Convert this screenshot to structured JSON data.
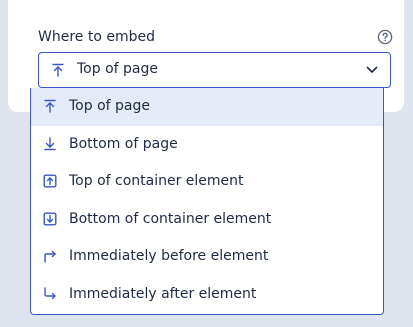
{
  "field": {
    "label": "Where to embed",
    "help_icon": "question-circle-icon",
    "selected_value": "Top of page",
    "selected_icon": "arrow-to-top-icon",
    "dropdown_icon": "chevron-down-icon"
  },
  "options": [
    {
      "label": "Top of page",
      "icon": "arrow-to-top-icon",
      "selected": true
    },
    {
      "label": "Bottom of page",
      "icon": "arrow-to-bottom-icon",
      "selected": false
    },
    {
      "label": "Top of container element",
      "icon": "box-arrow-up-icon",
      "selected": false
    },
    {
      "label": "Bottom of container element",
      "icon": "box-arrow-down-icon",
      "selected": false
    },
    {
      "label": "Immediately before element",
      "icon": "arrow-turn-right-icon",
      "selected": false
    },
    {
      "label": "Immediately after element",
      "icon": "arrow-turn-down-right-icon",
      "selected": false
    }
  ],
  "colors": {
    "accent": "#3957c6",
    "selected_bg": "#e5ebf8",
    "page_bg": "#dfe5ee",
    "text": "#1f2a44"
  }
}
